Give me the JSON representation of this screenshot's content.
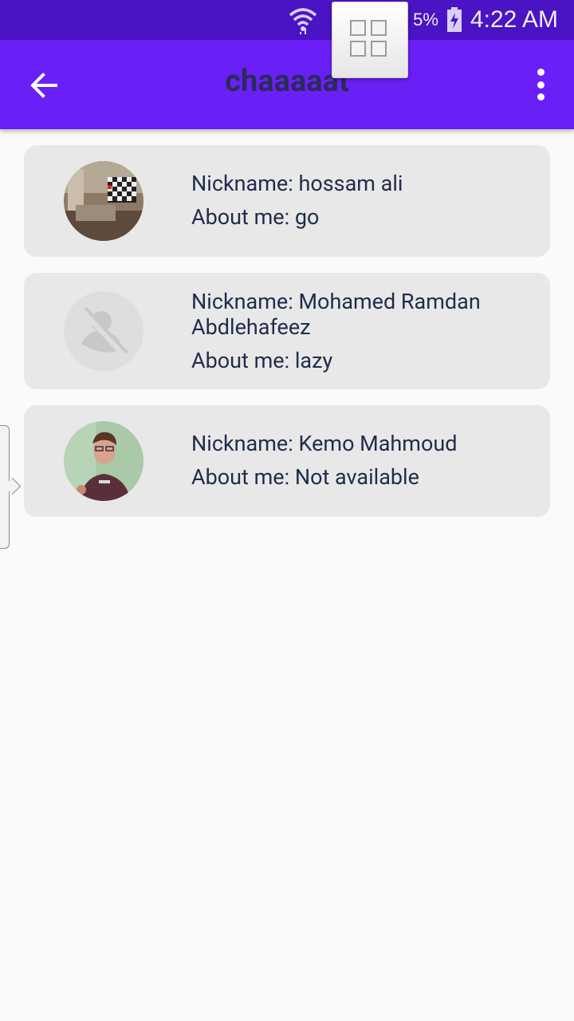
{
  "status_bar": {
    "time": "4:22 AM",
    "battery_text": "5%",
    "icons": [
      "wifi-icon",
      "battery-charging-icon"
    ]
  },
  "app_bar": {
    "title": "chaaaaat",
    "back_icon": "arrow-back-icon",
    "menu_icon": "more-vert-icon"
  },
  "floating_widget": {
    "icon": "grid-icon"
  },
  "users": [
    {
      "nickname": "Nickname: hossam ali",
      "about": "About me: go",
      "avatar": "room-photo"
    },
    {
      "nickname": "Nickname: Mohamed Ramdan Abdlehafeez",
      "about": "About me: lazy",
      "avatar": "no-photo-placeholder"
    },
    {
      "nickname": "Nickname: Kemo Mahmoud",
      "about": "About me: Not available",
      "avatar": "person-photo"
    }
  ],
  "colors": {
    "status_bar": "#4a14c4",
    "app_bar": "#6a1ff7",
    "title_text": "#2a2c58",
    "card_bg": "#e8e8e8",
    "card_text": "#1f2d4b"
  }
}
